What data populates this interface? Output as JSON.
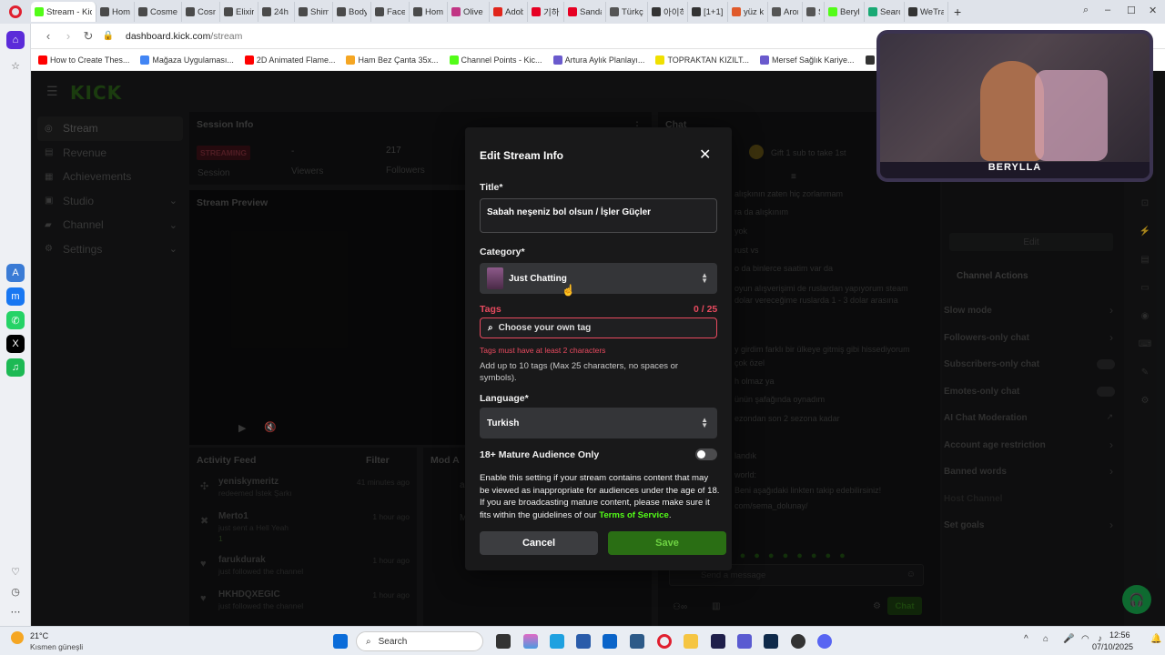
{
  "browser": {
    "tabs": [
      {
        "label": "Stream - Kick",
        "color": "#53fc18",
        "active": true
      },
      {
        "label": "Home",
        "color": "#4a4a4a"
      },
      {
        "label": "Cosme",
        "color": "#4a4a4a"
      },
      {
        "label": "Cosme",
        "color": "#4a4a4a"
      },
      {
        "label": "Elixir V",
        "color": "#4a4a4a"
      },
      {
        "label": "24h M",
        "color": "#4a4a4a"
      },
      {
        "label": "Shimm",
        "color": "#4a4a4a"
      },
      {
        "label": "Body B",
        "color": "#4a4a4a"
      },
      {
        "label": "Face a",
        "color": "#4a4a4a"
      },
      {
        "label": "Home",
        "color": "#4a4a4a"
      },
      {
        "label": "Olive S",
        "color": "#c13584"
      },
      {
        "label": "Adobe",
        "color": "#e1251b"
      },
      {
        "label": "기하치",
        "color": "#e60023"
      },
      {
        "label": "Sandal",
        "color": "#e60023"
      },
      {
        "label": "Türkçe",
        "color": "#555555"
      },
      {
        "label": "아이하",
        "color": "#333333"
      },
      {
        "label": "[1+1]",
        "color": "#333333"
      },
      {
        "label": "yüz krı",
        "color": "#e05a2b"
      },
      {
        "label": "Arony",
        "color": "#555555"
      },
      {
        "label": "Sky",
        "color": "#555555"
      },
      {
        "label": "Beryll",
        "color": "#53fc18"
      },
      {
        "label": "Search",
        "color": "#19a974"
      },
      {
        "label": "WeTra",
        "color": "#333333"
      }
    ],
    "url_host": "dashboard.kick.com",
    "url_path": "/stream",
    "bookmarks": [
      {
        "label": "How to Create Thes...",
        "color": "#ff0000"
      },
      {
        "label": "Mağaza Uygulaması...",
        "color": "#4285f4"
      },
      {
        "label": "2D Animated Flame...",
        "color": "#ff0000"
      },
      {
        "label": "Ham Bez Çanta 35x...",
        "color": "#f5a623"
      },
      {
        "label": "Channel Points - Kic...",
        "color": "#53fc18"
      },
      {
        "label": "Artura Aylık Planlayı...",
        "color": "#6a5acd"
      },
      {
        "label": "TOPRAKTAN KIZILT...",
        "color": "#f0e000"
      },
      {
        "label": "Mersef Sağlık Kariye...",
        "color": "#6a5acd"
      },
      {
        "label": "메디플라워",
        "color": "#333333"
      }
    ]
  },
  "sidebar": {
    "logo": "KICK",
    "items": [
      {
        "label": "Stream",
        "icon": "stream-icon",
        "chevron": false
      },
      {
        "label": "Revenue",
        "icon": "revenue-icon",
        "chevron": false
      },
      {
        "label": "Achievements",
        "icon": "trophy-icon",
        "chevron": false
      },
      {
        "label": "Studio",
        "icon": "studio-icon",
        "chevron": true
      },
      {
        "label": "Channel",
        "icon": "channel-icon",
        "chevron": true
      },
      {
        "label": "Settings",
        "icon": "gear-icon",
        "chevron": true
      }
    ]
  },
  "session": {
    "title": "Session Info",
    "status": "STREAMING",
    "status_label": "Session",
    "viewers_value": "-",
    "viewers_label": "Viewers",
    "followers_value": "217",
    "followers_label": "Followers"
  },
  "preview": {
    "title": "Stream Preview"
  },
  "activity": {
    "title": "Activity Feed",
    "filter_label": "Filter",
    "items": [
      {
        "name": "yeniskymeritz",
        "detail": "redeemed İstek Şarkı",
        "time": "41 minutes ago"
      },
      {
        "name": "Merto1",
        "detail": "just sent a Hell Yeah",
        "extra": "1",
        "time": "1 hour ago"
      },
      {
        "name": "farukdurak",
        "detail": "just followed the channel",
        "time": "1 hour ago"
      },
      {
        "name": "HKHDQXEGIC",
        "detail": "just followed the channel",
        "time": "1 hour ago"
      }
    ]
  },
  "mod": {
    "title": "Mod A",
    "items": [
      "acı",
      "Ma"
    ]
  },
  "chat": {
    "title": "Chat",
    "gift_text": "Gift 1 sub to take 1st",
    "messages": [
      "alışkının zaten hiç zorlanmam",
      "ra da alışkınım",
      "yok",
      "rust vs",
      "o da binlerce saatim var da",
      "oyun alışverişimi de ruslardan yapıyorum steam",
      "dolar vereceğime ruslarda 1 - 3 dolar arasına",
      "y girdim farklı bir ülkeye gitmiş gibi hissediyorum",
      "çok özel",
      "h olmaz ya",
      "ünün şafağında oynadım",
      "ezondan son 2 sezona kadar",
      "landık",
      "world:",
      "Beni aşağıdaki linkten takip edebilirsiniz!",
      "com/sema_dolunay/"
    ],
    "input_placeholder": "Send a message",
    "chat_button": "Chat"
  },
  "channel_actions": {
    "edit_label": "Edit",
    "title": "Channel Actions",
    "items": [
      {
        "label": "Slow mode",
        "type": "chevron"
      },
      {
        "label": "Followers-only chat",
        "type": "chevron"
      },
      {
        "label": "Subscribers-only chat",
        "type": "toggle"
      },
      {
        "label": "Emotes-only chat",
        "type": "toggle"
      },
      {
        "label": "AI Chat Moderation",
        "type": "external"
      },
      {
        "label": "Account age restriction",
        "type": "chevron"
      },
      {
        "label": "Banned words",
        "type": "chevron"
      },
      {
        "label": "Host Channel",
        "type": "disabled"
      },
      {
        "label": "Set goals",
        "type": "chevron"
      }
    ]
  },
  "modal": {
    "title": "Edit Stream Info",
    "title_label": "Title*",
    "title_value": "Sabah neşeniz bol olsun / İşler Güçler",
    "category_label": "Category*",
    "category_value": "Just Chatting",
    "tags_label": "Tags",
    "tags_count": "0 / 25",
    "tags_placeholder": "Choose your own tag",
    "tags_error": "Tags must have at least 2 characters",
    "tags_help": "Add up to 10 tags (Max 25 characters, no spaces or symbols).",
    "language_label": "Language*",
    "language_value": "Turkish",
    "mature_label": "18+ Mature Audience Only",
    "mature_on": false,
    "mature_desc": "Enable this setting if your stream contains content that may be viewed as inappropriate for audiences under the age of 18. If you are broadcasting mature content, please make sure it fits within the guidelines of our",
    "tos_link": "Terms of Service",
    "tos_end": ".",
    "cancel_label": "Cancel",
    "save_label": "Save",
    "accent": "#53fc18"
  },
  "webcam": {
    "name": "BERYLLA"
  },
  "taskbar": {
    "weather_temp": "21°C",
    "weather_desc": "Kısmen güneşli",
    "search_placeholder": "Search",
    "time": "12:56",
    "date": "07/10/2025"
  }
}
